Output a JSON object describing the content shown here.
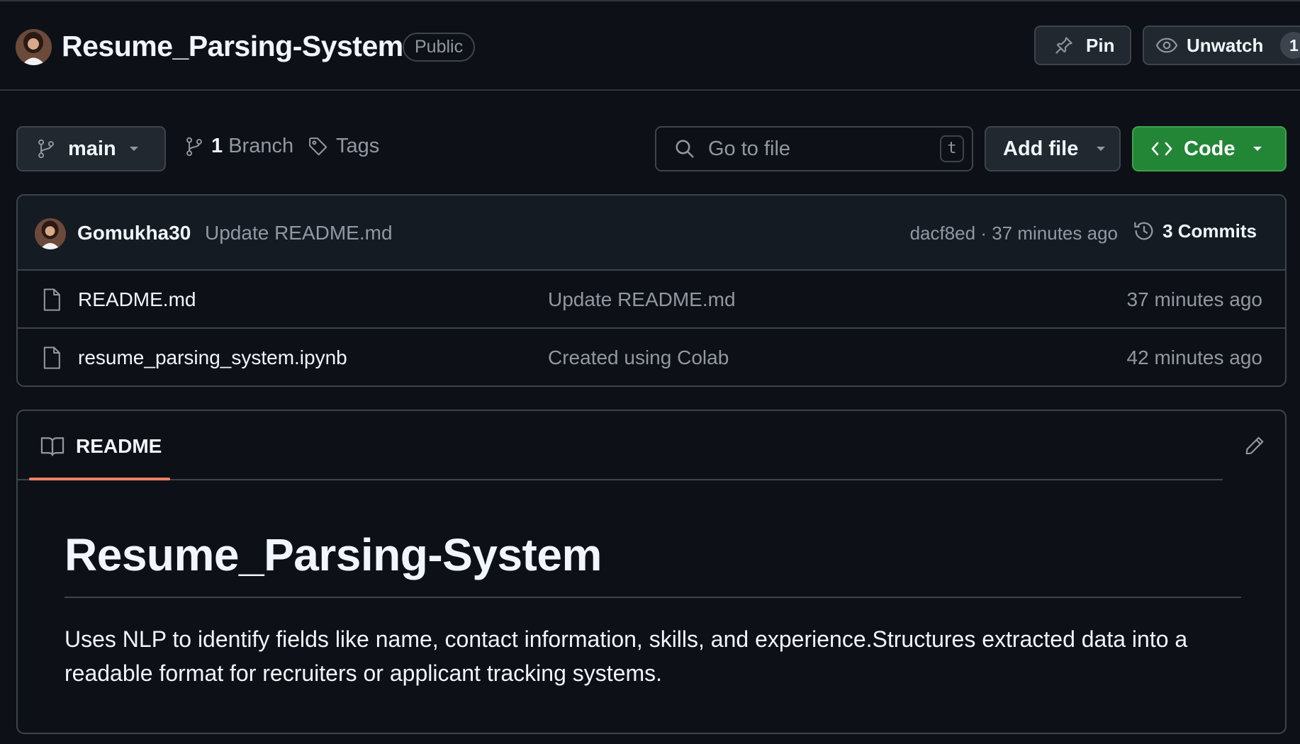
{
  "header": {
    "repo_name": "Resume_Parsing-System",
    "visibility": "Public",
    "pin_label": "Pin",
    "watch_label": "Unwatch",
    "watch_count": "1"
  },
  "toolbar": {
    "branch_name": "main",
    "branch_count": "1",
    "branch_label": "Branch",
    "tags_label": "Tags",
    "search_placeholder": "Go to file",
    "search_shortcut": "t",
    "add_file_label": "Add file",
    "code_label": "Code"
  },
  "latest_commit": {
    "author": "Gomukha30",
    "message": "Update README.md",
    "meta": "dacf8ed · 37 minutes ago",
    "commits_label": "3 Commits"
  },
  "files": [
    {
      "name": "README.md",
      "message": "Update README.md",
      "time": "37 minutes ago",
      "icon": "file-icon"
    },
    {
      "name": "resume_parsing_system.ipynb",
      "message": "Created using Colab",
      "time": "42 minutes ago",
      "icon": "file-icon"
    }
  ],
  "readme": {
    "tab_label": "README",
    "title": "Resume_Parsing-System",
    "body": "Uses NLP to identify fields like name, contact information, skills, and experience.Structures extracted data into a readable format for recruiters or applicant tracking systems."
  },
  "colors": {
    "background": "#0d1117",
    "border": "#3d444d",
    "primary_button": "#238636",
    "tab_underline": "#f78166",
    "muted_text": "#9198a1"
  }
}
